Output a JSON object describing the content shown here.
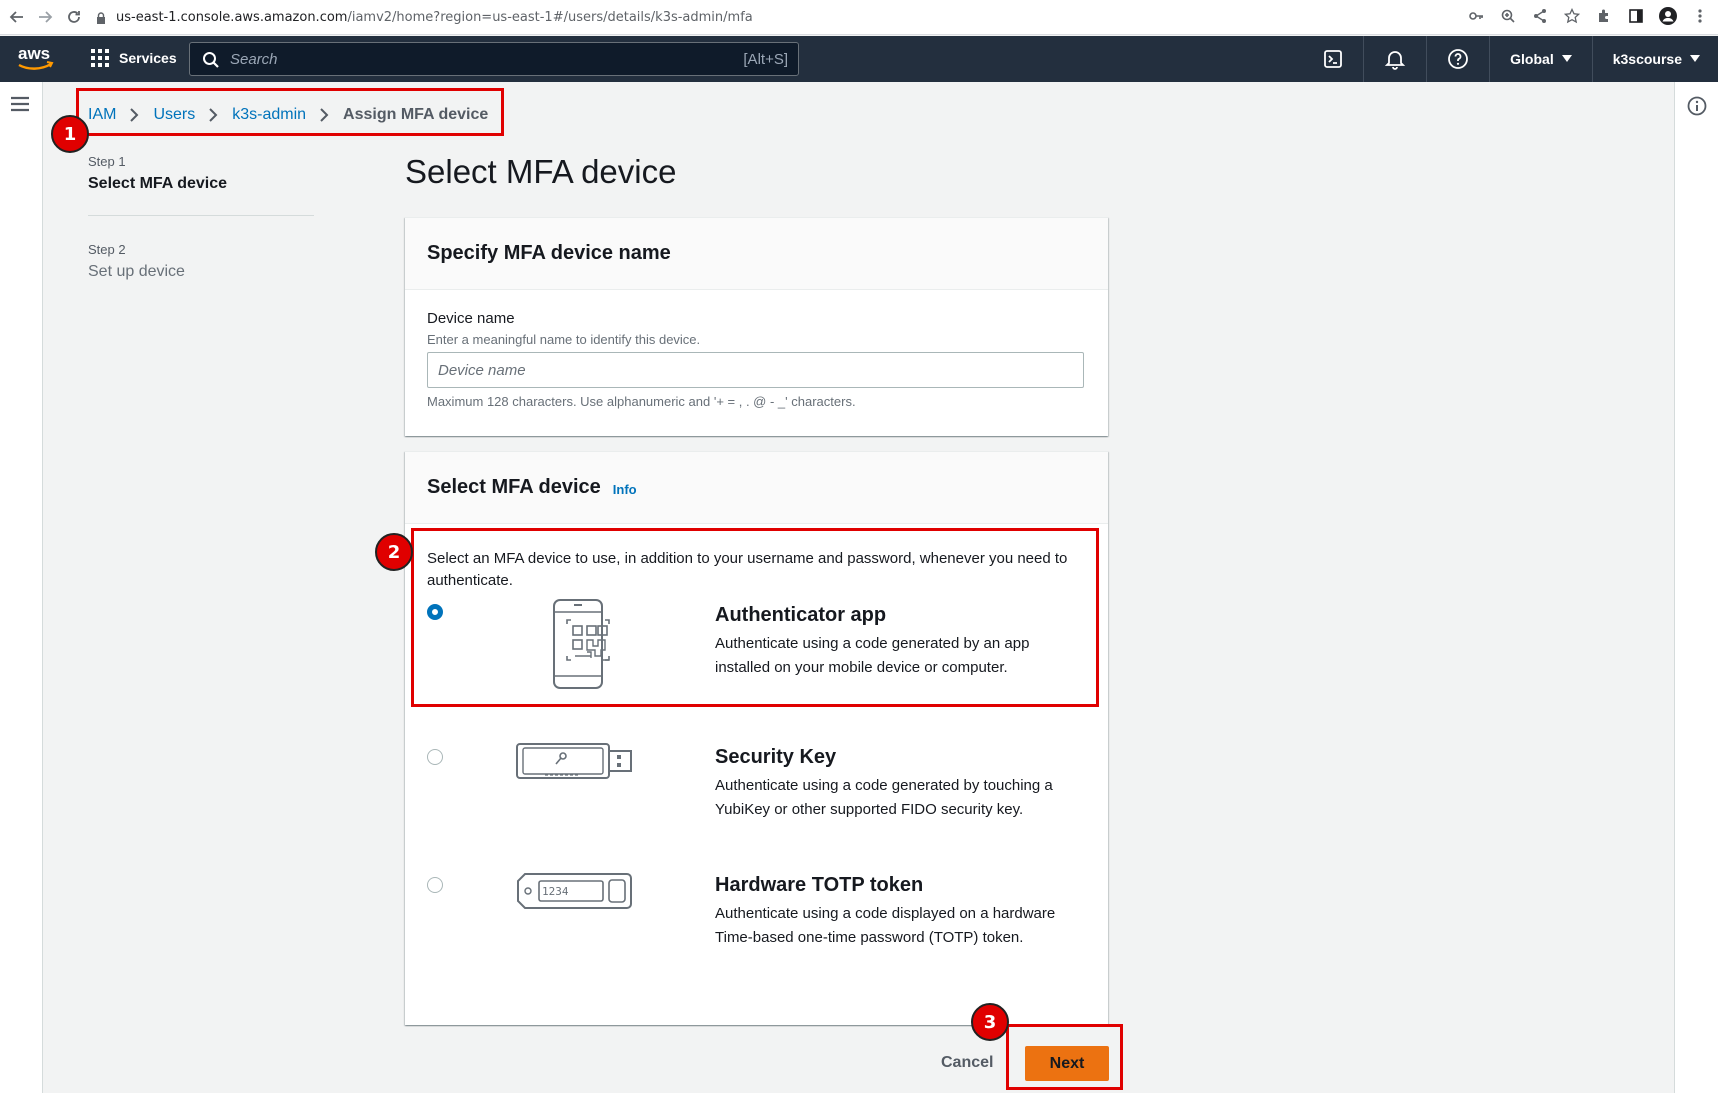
{
  "browser": {
    "url_host": "us-east-1.console.aws.amazon.com",
    "url_path": "/iamv2/home?region=us-east-1#/users/details/k3s-admin/mfa"
  },
  "awsnav": {
    "logo_text": "aws",
    "services_label": "Services",
    "search_placeholder": "Search",
    "search_shortcut": "[Alt+S]",
    "region_label": "Global",
    "account_label": "k3scourse"
  },
  "breadcrumb": {
    "items": [
      "IAM",
      "Users",
      "k3s-admin"
    ],
    "current": "Assign MFA device"
  },
  "steps": [
    {
      "label": "Step 1",
      "title": "Select MFA device"
    },
    {
      "label": "Step 2",
      "title": "Set up device"
    }
  ],
  "page_title": "Select MFA device",
  "name_panel": {
    "heading": "Specify MFA device name",
    "field_label": "Device name",
    "field_description": "Enter a meaningful name to identify this device.",
    "placeholder": "Device name",
    "value": "",
    "constraint": "Maximum 128 characters. Use alphanumeric and '+ = , . @ - _' characters."
  },
  "mfa_panel": {
    "heading": "Select MFA device",
    "info_link": "Info",
    "intro": "Select an MFA device to use, in addition to your username and password, whenever you need to authenticate.",
    "options": [
      {
        "title": "Authenticator app",
        "description": "Authenticate using a code generated by an app installed on your mobile device or computer.",
        "selected": true
      },
      {
        "title": "Security Key",
        "description": "Authenticate using a code generated by touching a YubiKey or other supported FIDO security key.",
        "selected": false
      },
      {
        "title": "Hardware TOTP token",
        "description": "Authenticate using a code displayed on a hardware Time-based one-time password (TOTP) token.",
        "selected": false
      }
    ],
    "token_display": "1234"
  },
  "actions": {
    "cancel_label": "Cancel",
    "next_label": "Next"
  },
  "annotations": [
    "1",
    "2",
    "3"
  ],
  "colors": {
    "accent": "#0073bb",
    "primary_button": "#ec7211",
    "nav_bg": "#232f3e",
    "annotation_red": "#e00000"
  }
}
